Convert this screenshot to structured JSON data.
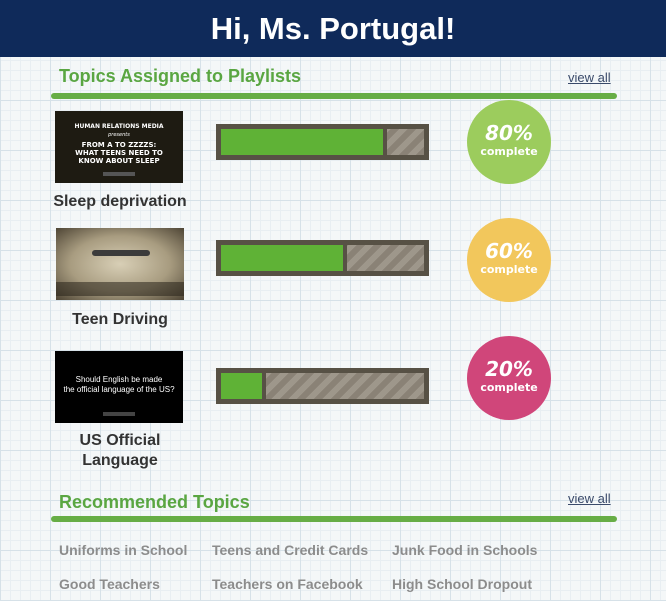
{
  "header": {
    "greeting": "Hi, Ms. Portugal!"
  },
  "assigned": {
    "title": "Topics Assigned to Playlists",
    "view_all": "view all",
    "items": [
      {
        "label": "Sleep deprivation",
        "thumb": {
          "lines": [
            "HUMAN RELATIONS MEDIA",
            "presents",
            "FROM A TO ZZZZS:",
            "WHAT TEENS NEED TO",
            "KNOW ABOUT SLEEP"
          ]
        },
        "progress": 0.8,
        "percent": "80%",
        "complete": "complete",
        "color": "#9ccc5d"
      },
      {
        "label": "Teen Driving",
        "thumb": {
          "lines": []
        },
        "progress": 0.6,
        "percent": "60%",
        "complete": "complete",
        "color": "#f2c75c"
      },
      {
        "label": "US Official Language",
        "thumb": {
          "lines": [
            "Should English be made",
            "the official language of the US?"
          ]
        },
        "progress": 0.2,
        "percent": "20%",
        "complete": "complete",
        "color": "#d0467a"
      }
    ]
  },
  "recommended": {
    "title": "Recommended Topics",
    "view_all": "view all",
    "topics": [
      "Uniforms in School",
      "Teens and Credit Cards",
      "Junk Food in Schools",
      "Good Teachers",
      "Teachers on Facebook",
      "High School Dropout"
    ]
  }
}
